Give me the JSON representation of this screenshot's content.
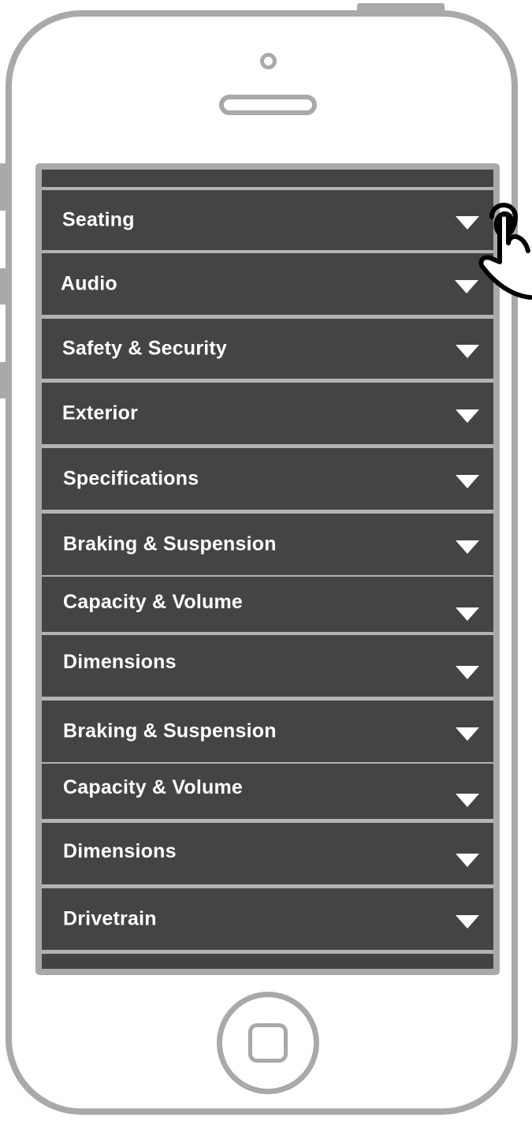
{
  "accordion": {
    "items": [
      {
        "label": "Seating"
      },
      {
        "label": "Audio"
      },
      {
        "label": "Safety & Security"
      },
      {
        "label": "Exterior"
      },
      {
        "label": "Specifications"
      },
      {
        "label": "Braking & Suspension"
      },
      {
        "label": "Capacity & Volume"
      },
      {
        "label": "Dimensions"
      },
      {
        "label": "Braking & Suspension"
      },
      {
        "label": "Capacity & Volume"
      },
      {
        "label": "Dimensions"
      },
      {
        "label": "Drivetrain"
      }
    ]
  },
  "icons": {
    "expand": "chevron-down-icon",
    "pointer": "hand-pointer-icon",
    "home": "home-button",
    "camera": "camera-icon",
    "speaker": "speaker-slot"
  },
  "colors": {
    "phone_outline": "#a9a9a9",
    "row_background": "#444444",
    "row_divider": "#b3b3b3",
    "label_text": "#ffffff"
  }
}
